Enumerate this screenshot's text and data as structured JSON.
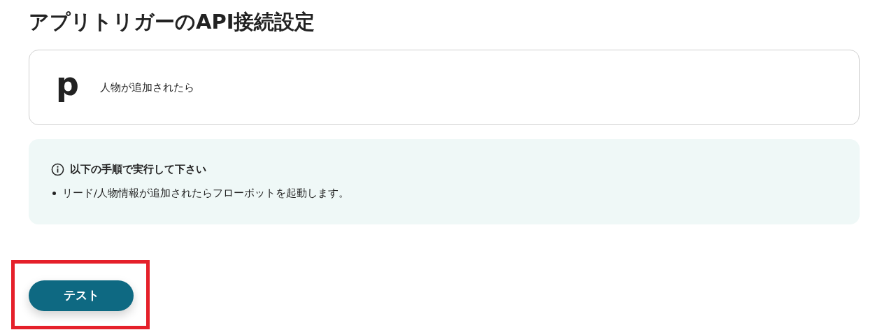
{
  "title": "アプリトリガーのAPI接続設定",
  "trigger": {
    "app_logo": "p",
    "label": "人物が追加されたら"
  },
  "info": {
    "heading": "以下の手順で実行して下さい",
    "items": [
      "リード/人物情報が追加されたらフローボットを起動します。"
    ]
  },
  "button": {
    "label": "テスト",
    "highlighted": true
  }
}
